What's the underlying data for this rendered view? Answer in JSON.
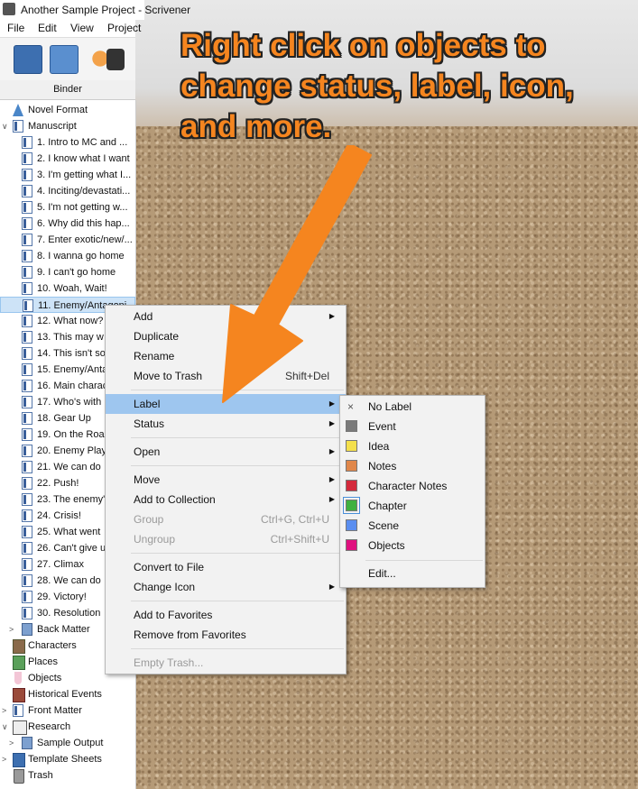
{
  "window": {
    "title": "Another Sample Project - Scrivener"
  },
  "menubar": {
    "items": [
      "File",
      "Edit",
      "View",
      "Project"
    ]
  },
  "binder": {
    "header": "Binder",
    "novel_format": "Novel Format",
    "manuscript": "Manuscript",
    "chapters": [
      "1. Intro to MC and ...",
      "2. I know what I want",
      "3. I'm getting what I...",
      "4. Inciting/devastati...",
      "5. I'm not getting w...",
      "6. Why did this hap...",
      "7. Enter exotic/new/...",
      "8. I wanna go home",
      "9. I can't go home",
      "10. Woah, Wait!",
      "11. Enemy/Antagoni",
      "12. What now?",
      "13. This may w",
      "14. This isn't so",
      "15. Enemy/Anta",
      "16. Main charac",
      "17. Who's with",
      "18. Gear Up",
      "19. On the Roa",
      "20. Enemy Play",
      "21. We can do",
      "22. Push!",
      "23. The enemy'",
      "24. Crisis!",
      "25. What went",
      "26. Can't give u",
      "27. Climax",
      "28. We can do",
      "29. Victory!",
      "30. Resolution"
    ],
    "back_matter": "Back Matter",
    "characters": "Characters",
    "places": "Places",
    "objects": "Objects",
    "historical_events": "Historical Events",
    "front_matter": "Front Matter",
    "research": "Research",
    "sample_output": "Sample Output",
    "template_sheets": "Template Sheets",
    "trash": "Trash"
  },
  "annotation": {
    "text": "Right click on objects to change status, label, icon, and more."
  },
  "context_menu": {
    "add": "Add",
    "duplicate": "Duplicate",
    "rename": "Rename",
    "move_to_trash": "Move to Trash",
    "move_to_trash_shortcut": "Shift+Del",
    "label": "Label",
    "status": "Status",
    "open": "Open",
    "move": "Move",
    "add_to_collection": "Add to Collection",
    "group": "Group",
    "group_shortcut": "Ctrl+G, Ctrl+U",
    "ungroup": "Ungroup",
    "ungroup_shortcut": "Ctrl+Shift+U",
    "convert_to_file": "Convert to File",
    "change_icon": "Change Icon",
    "add_to_favorites": "Add to Favorites",
    "remove_from_favorites": "Remove from Favorites",
    "empty_trash": "Empty Trash..."
  },
  "label_submenu": {
    "items": [
      {
        "name": "No Label",
        "color": ""
      },
      {
        "name": "Event",
        "color": "#7a7a7a"
      },
      {
        "name": "Idea",
        "color": "#f4e04d"
      },
      {
        "name": "Notes",
        "color": "#e0874a"
      },
      {
        "name": "Character Notes",
        "color": "#d42a3c"
      },
      {
        "name": "Chapter",
        "color": "#3fb13f"
      },
      {
        "name": "Scene",
        "color": "#5a8ef0"
      },
      {
        "name": "Objects",
        "color": "#e0117f"
      }
    ],
    "edit": "Edit..."
  }
}
